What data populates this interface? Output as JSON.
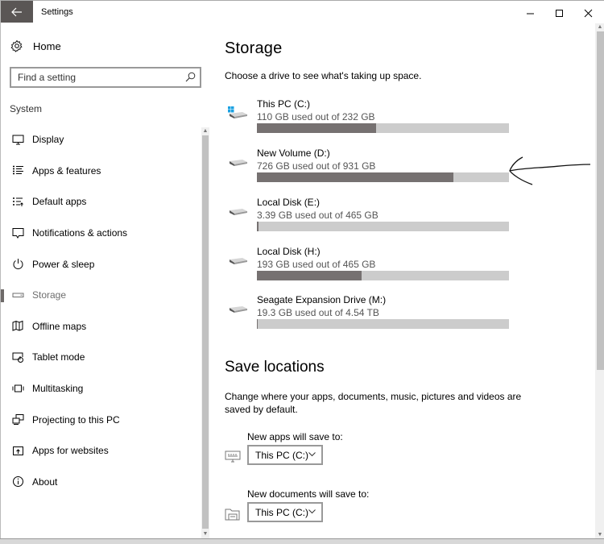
{
  "window": {
    "title": "Settings",
    "controls": {
      "minimize": "minimize-icon",
      "maximize": "maximize-icon",
      "close": "close-icon"
    }
  },
  "sidebar": {
    "home_label": "Home",
    "search_placeholder": "Find a setting",
    "section_label": "System",
    "items": [
      {
        "label": "Display",
        "icon": "monitor-icon",
        "active": false
      },
      {
        "label": "Apps & features",
        "icon": "list-icon",
        "active": false
      },
      {
        "label": "Default apps",
        "icon": "default-apps-icon",
        "active": false
      },
      {
        "label": "Notifications & actions",
        "icon": "message-icon",
        "active": false
      },
      {
        "label": "Power & sleep",
        "icon": "power-icon",
        "active": false
      },
      {
        "label": "Storage",
        "icon": "storage-icon",
        "active": true
      },
      {
        "label": "Offline maps",
        "icon": "map-icon",
        "active": false
      },
      {
        "label": "Tablet mode",
        "icon": "tablet-icon",
        "active": false
      },
      {
        "label": "Multitasking",
        "icon": "multitasking-icon",
        "active": false
      },
      {
        "label": "Projecting to this PC",
        "icon": "projecting-icon",
        "active": false
      },
      {
        "label": "Apps for websites",
        "icon": "apps-websites-icon",
        "active": false
      },
      {
        "label": "About",
        "icon": "info-icon",
        "active": false
      }
    ]
  },
  "main": {
    "title": "Storage",
    "description": "Choose a drive to see what's taking up space.",
    "drives": [
      {
        "name": "This PC (C:)",
        "usage": "110 GB used out of 232 GB",
        "used_fraction": 0.474,
        "system": true
      },
      {
        "name": "New Volume (D:)",
        "usage": "726 GB used out of 931 GB",
        "used_fraction": 0.78,
        "system": false
      },
      {
        "name": "Local Disk (E:)",
        "usage": "3.39 GB used out of 465 GB",
        "used_fraction": 0.007,
        "system": false
      },
      {
        "name": "Local Disk (H:)",
        "usage": "193 GB used out of 465 GB",
        "used_fraction": 0.415,
        "system": false
      },
      {
        "name": "Seagate Expansion Drive (M:)",
        "usage": "19.3 GB used out of 4.54 TB",
        "used_fraction": 0.004,
        "system": false
      }
    ],
    "save_locations": {
      "title": "Save locations",
      "description": "Change where your apps, documents, music, pictures and videos are saved by default.",
      "rows": [
        {
          "label": "New apps will save to:",
          "value": "This PC (C:)",
          "icon": "apps-save-icon"
        },
        {
          "label": "New documents will save to:",
          "value": "This PC (C:)",
          "icon": "documents-save-icon"
        }
      ]
    }
  },
  "colors": {
    "used_bar": "#767171",
    "free_bar": "#cccccc",
    "back_button": "#5a5655"
  }
}
